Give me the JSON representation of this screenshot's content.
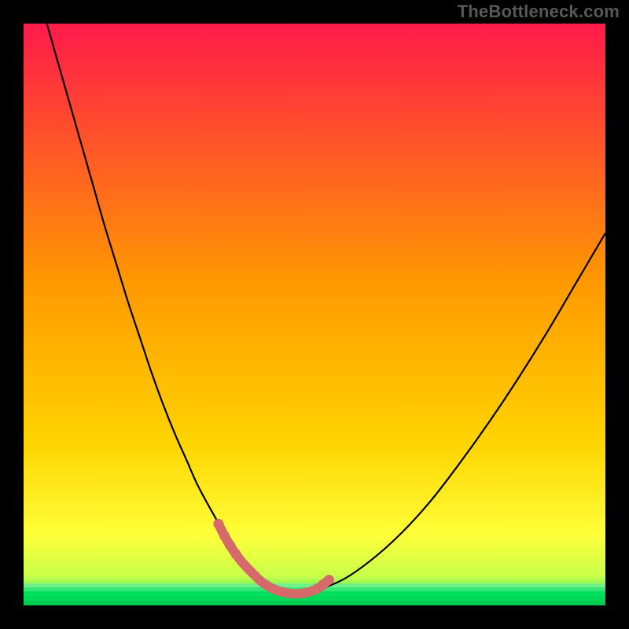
{
  "watermark": "TheBottleneck.com",
  "colors": {
    "frame": "#000000",
    "gradient_top": "#ff1a4b",
    "gradient_mid": "#ffd400",
    "gradient_bottom_y": "#ffff3a",
    "gradient_green": "#00e060",
    "curve": "#000000",
    "highlight": "#d66a6a"
  },
  "chart_data": {
    "type": "line",
    "title": "",
    "xlabel": "",
    "ylabel": "",
    "xlim": [
      0,
      100
    ],
    "ylim": [
      0,
      100
    ],
    "series": [
      {
        "name": "bottleneck-curve",
        "x": [
          4,
          6,
          8,
          10,
          12,
          14,
          16,
          18,
          20,
          22,
          24,
          26,
          28,
          30,
          33,
          35,
          37,
          38,
          40,
          42,
          44,
          47,
          50,
          55,
          60,
          65,
          70,
          75,
          80,
          85,
          90,
          95,
          100
        ],
        "y": [
          100,
          93,
          86,
          79,
          72,
          65,
          58.5,
          52,
          46,
          40,
          34.5,
          29.5,
          25,
          20.5,
          15,
          11.5,
          8.5,
          7,
          5,
          3.5,
          2.5,
          2,
          2.5,
          4.5,
          8,
          12.5,
          18,
          24.5,
          31.5,
          39,
          47,
          55.5,
          64
        ]
      },
      {
        "name": "highlight-segment",
        "x": [
          33.5,
          34.5,
          35.5,
          36.5,
          37.5,
          38.5,
          39.5,
          41,
          43,
          45,
          47,
          49,
          50.5,
          51.5,
          52.5
        ],
        "y": [
          14,
          12,
          10.3,
          8.8,
          7.5,
          6.4,
          5.4,
          4,
          2.8,
          2.2,
          2,
          2.3,
          2.9,
          3.6,
          4.4
        ]
      }
    ],
    "annotations": []
  }
}
